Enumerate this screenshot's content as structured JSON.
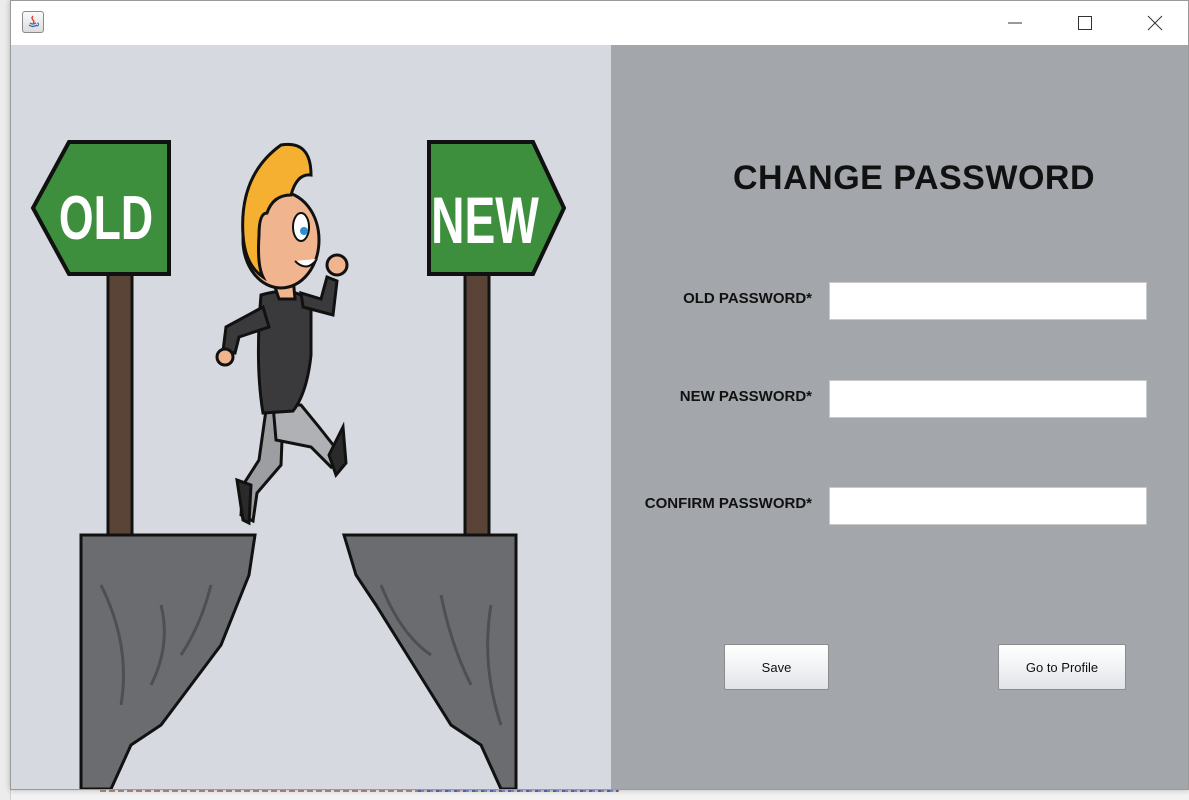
{
  "window": {
    "controls": {
      "minimize_icon": "minimize-icon",
      "maximize_icon": "maximize-icon",
      "close_icon": "close-icon"
    }
  },
  "illustration": {
    "left_sign": "OLD",
    "right_sign": "NEW",
    "sign_color": "#3d8f3d"
  },
  "form": {
    "title": "CHANGE PASSWORD",
    "fields": [
      {
        "label": "OLD PASSWORD*",
        "value": ""
      },
      {
        "label": "NEW PASSWORD*",
        "value": ""
      },
      {
        "label": "CONFIRM PASSWORD*",
        "value": ""
      }
    ],
    "save_label": "Save",
    "profile_label": "Go to Profile"
  },
  "colors": {
    "left_panel_bg": "#d6d9e0",
    "right_panel_bg": "#a3a6aa"
  }
}
